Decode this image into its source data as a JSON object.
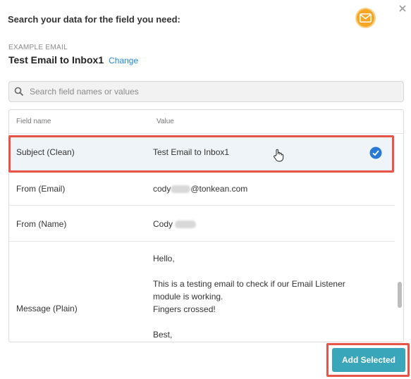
{
  "header": {
    "title": "Search your data for the field you need:",
    "icon": "mail-icon",
    "close_icon": "close-icon",
    "accent_color": "#f5a623"
  },
  "example": {
    "label": "EXAMPLE EMAIL",
    "title": "Test Email to Inbox1",
    "change_label": "Change",
    "link_color": "#1e88e5"
  },
  "search": {
    "placeholder": "Search field names or values",
    "value": ""
  },
  "table": {
    "headers": {
      "field": "Field name",
      "value": "Value"
    },
    "rows": [
      {
        "field": "Subject (Clean)",
        "value": "Test Email to Inbox1",
        "selected": true
      },
      {
        "field": "From (Email)",
        "value_prefix": "cody",
        "value_suffix": "@tonkean.com"
      },
      {
        "field": "From (Name)",
        "value_prefix": "Cody"
      },
      {
        "field": "Message (Plain)",
        "value_lines": "Hello,\n\nThis is a testing email to check if our Email Listener\nmodule is working.\nFingers crossed!\n\nBest,"
      }
    ]
  },
  "footer": {
    "add_label": "Add Selected",
    "button_color": "#3aa6b9",
    "highlight_color": "#e8534a"
  }
}
